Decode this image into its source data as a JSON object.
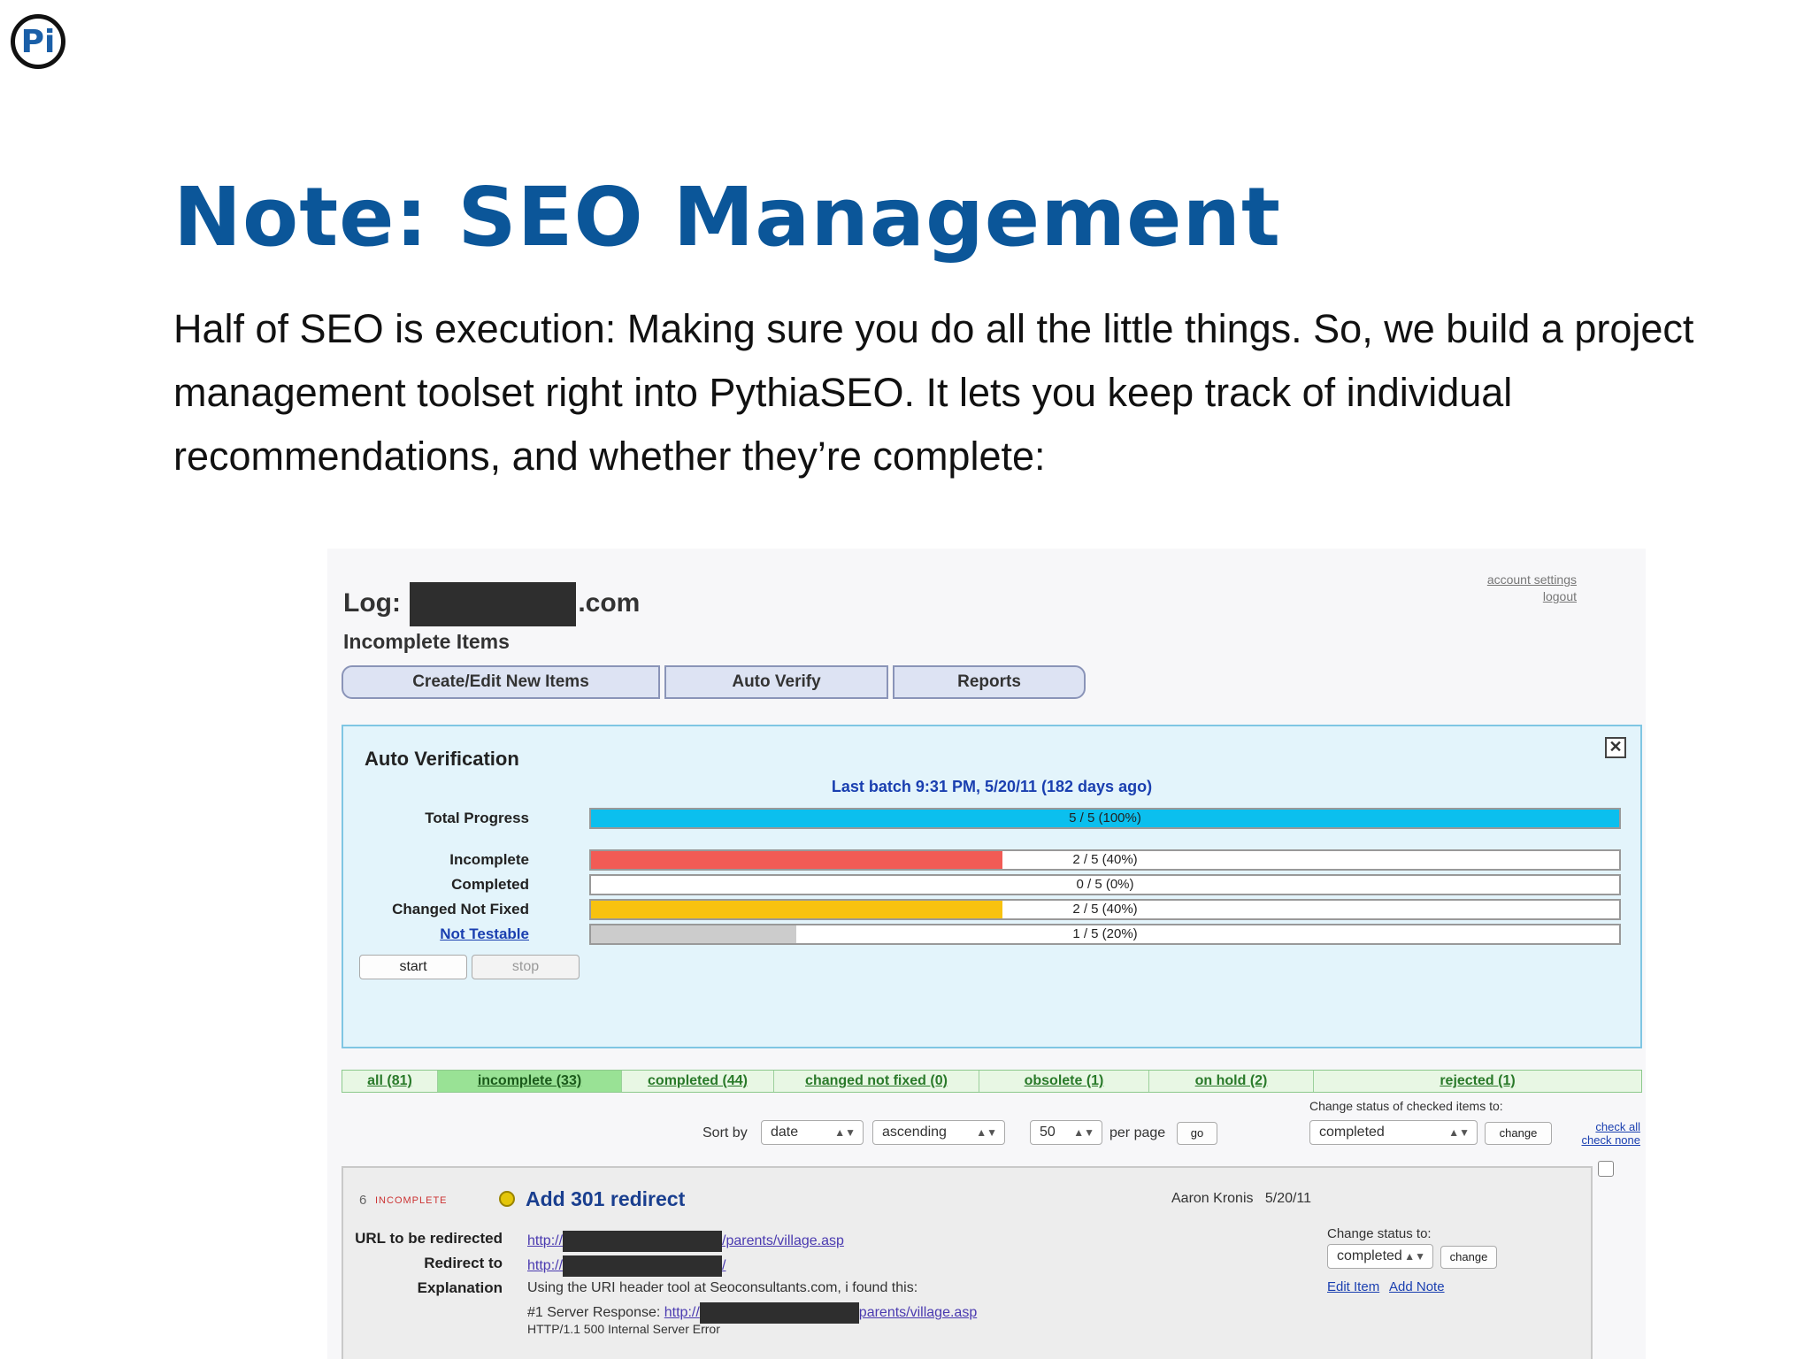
{
  "slide": {
    "logo_text": "Pi",
    "title": "Note: SEO Management",
    "intro": "Half of SEO is execution: Making sure you do all the little things. So, we build a project management toolset right into PythiaSEO. It lets you keep track of individual recommendations, and whether they’re complete:"
  },
  "app": {
    "log_prefix": "Log:",
    "log_suffix": ".com",
    "subtitle": "Incomplete Items",
    "account_settings": "account settings",
    "logout": "logout",
    "tabs": [
      {
        "label": "Create/Edit New Items"
      },
      {
        "label": "Auto Verify"
      },
      {
        "label": "Reports"
      }
    ]
  },
  "auto_verification": {
    "title": "Auto Verification",
    "close_glyph": "✕",
    "last_batch": "Last batch 9:31 PM, 5/20/11 (182 days ago)",
    "rows": [
      {
        "label": "Total Progress",
        "text": "5 / 5 (100%)",
        "fraction": 1.0,
        "color": "#0bbfee",
        "link": false
      },
      {
        "label": "Incomplete",
        "text": "2 / 5 (40%)",
        "fraction": 0.4,
        "color": "#f25b55",
        "link": false
      },
      {
        "label": "Completed",
        "text": "0 / 5 (0%)",
        "fraction": 0.0,
        "color": "#5fc85a",
        "link": false
      },
      {
        "label": "Changed Not Fixed",
        "text": "2 / 5 (40%)",
        "fraction": 0.4,
        "color": "#f8c20f",
        "link": false
      },
      {
        "label": "Not Testable",
        "text": "1 / 5 (20%)",
        "fraction": 0.2,
        "color": "#cccccc",
        "link": true
      }
    ],
    "start_label": "start",
    "stop_label": "stop"
  },
  "filters": [
    {
      "label": "all (81)",
      "active": false
    },
    {
      "label": "incomplete (33)",
      "active": true
    },
    {
      "label": "completed (44)",
      "active": false
    },
    {
      "label": "changed not fixed (0)",
      "active": false
    },
    {
      "label": "obsolete (1)",
      "active": false
    },
    {
      "label": "on hold (2)",
      "active": false
    },
    {
      "label": "rejected (1)",
      "active": false
    }
  ],
  "sorting": {
    "sort_by_label": "Sort by",
    "sort_field": "date",
    "sort_order": "ascending",
    "per_page_value": "50",
    "per_page_label": "per page",
    "go_label": "go",
    "change_status_label": "Change status of checked items to:",
    "status_value": "completed",
    "change_label": "change",
    "check_all": "check all",
    "check_none": "check none"
  },
  "item": {
    "number": "6",
    "status": "INCOMPLETE",
    "title": "Add 301 redirect",
    "author": "Aaron Kronis",
    "date": "5/20/11",
    "fields": [
      {
        "label": "URL to be redirected",
        "prefix": "http://",
        "suffix": "/parents/village.asp"
      },
      {
        "label": "Redirect to",
        "prefix": "http://",
        "suffix": "/"
      },
      {
        "label": "Explanation",
        "text": "Using the URI header tool at Seoconsultants.com, i found this:"
      }
    ],
    "server_response_label": "#1 Server Response:",
    "server_response_prefix": "http://",
    "server_response_suffix": "parents/village.asp",
    "http_line": "HTTP/1.1 500 Internal Server Error",
    "change_status_to": "Change status to:",
    "status_value": "completed",
    "change_label": "change",
    "edit_item": "Edit Item",
    "add_note": "Add Note"
  }
}
